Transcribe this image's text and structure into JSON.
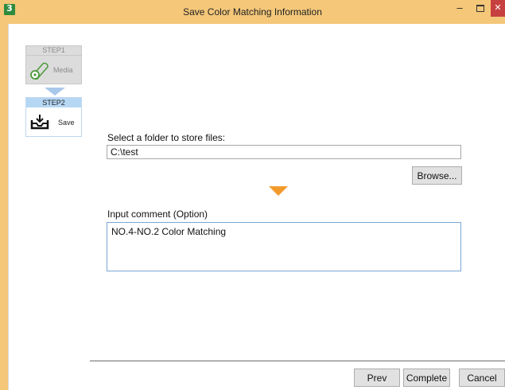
{
  "window": {
    "title": "Save Color Matching Information",
    "app_icon_glyph": "3",
    "minimize_glyph": "–",
    "close_glyph": "✕",
    "accent_color": "#f4c779"
  },
  "steps": [
    {
      "label": "STEP1",
      "name": "Media",
      "icon": "media-roll-icon",
      "active": false
    },
    {
      "label": "STEP2",
      "name": "Save",
      "icon": "save-tray-icon",
      "active": true
    }
  ],
  "form": {
    "folder_label": "Select a folder to store files:",
    "folder_value": "C:\\test",
    "browse_label": "Browse...",
    "comment_label": "Input comment (Option)",
    "comment_value": "NO.4-NO.2 Color Matching"
  },
  "footer": {
    "prev_label": "Prev",
    "complete_label": "Complete",
    "cancel_label": "Cancel"
  }
}
